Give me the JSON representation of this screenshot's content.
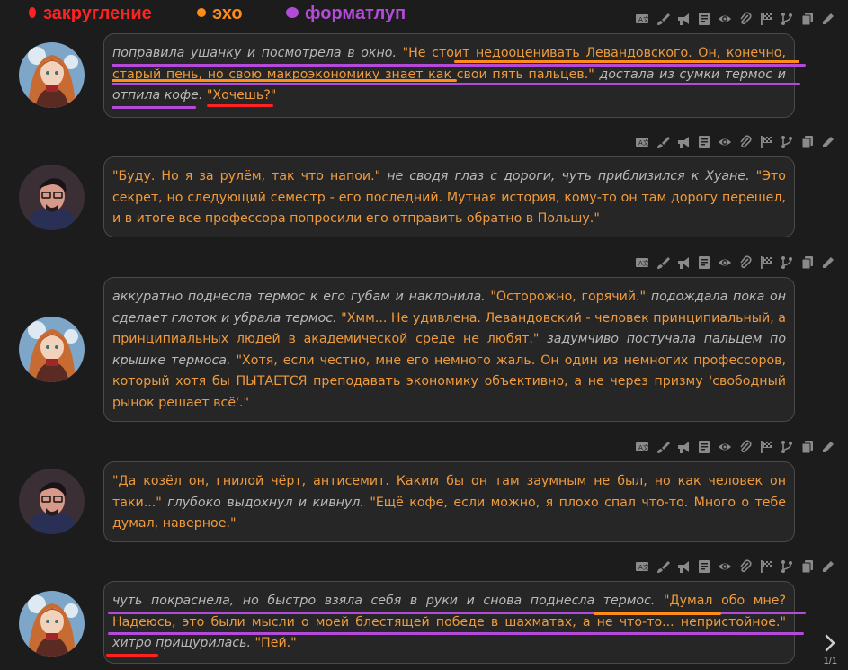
{
  "legend": [
    {
      "label": "закругление",
      "color": "#ff2222"
    },
    {
      "label": "эхо",
      "color": "#ff8c1a"
    },
    {
      "label": "форматлуп",
      "color": "#b44ad8"
    }
  ],
  "messages": [
    {
      "speaker": "girl",
      "parts": [
        {
          "t": "nar",
          "text": "поправила ушанку и посмотрела в окно. "
        },
        {
          "t": "sp",
          "text": "\"Не стоит недооценивать Левандовского. Он, конечно, старый пень, но свою макроэкономику знает как свои пять пальцев.\""
        },
        {
          "t": "nar",
          "text": " достала из сумки термос и отпила кофе. "
        },
        {
          "t": "sp",
          "text": "\"Хочешь?\""
        }
      ]
    },
    {
      "speaker": "guy",
      "parts": [
        {
          "t": "sp",
          "text": "\"Буду. Но я за рулём, так что напои.\""
        },
        {
          "t": "nar",
          "text": " не сводя глаз с дороги, чуть приблизился к Хуане. "
        },
        {
          "t": "sp",
          "text": "\"Это секрет, но следующий семестр - его последний. Мутная история, кому-то он там дорогу перешел, и в итоге все профессора попросили его отправить обратно в Польшу.\""
        }
      ]
    },
    {
      "speaker": "girl",
      "parts": [
        {
          "t": "nar",
          "text": "аккуратно поднесла термос к его губам и наклонила. "
        },
        {
          "t": "sp",
          "text": "\"Осторожно, горячий.\""
        },
        {
          "t": "nar",
          "text": " подождала пока он сделает глоток и убрала термос. "
        },
        {
          "t": "sp",
          "text": "\"Хмм... Не удивлена. Левандовский - человек принципиальный, а принципиальных людей в академической среде не любят.\""
        },
        {
          "t": "nar",
          "text": " задумчиво постучала пальцем по крышке термоса. "
        },
        {
          "t": "sp",
          "text": "\"Хотя, если честно, мне его немного жаль. Он один из немногих профессоров, который хотя бы ПЫТАЕТСЯ преподавать экономику объективно, а не через призму 'свободный рынок решает всё'.\""
        }
      ]
    },
    {
      "speaker": "guy",
      "parts": [
        {
          "t": "sp",
          "text": "\"Да козёл он, гнилой чёрт, антисемит. Каким бы он там заумным не был, но как человек он таки...\""
        },
        {
          "t": "nar",
          "text": " глубоко выдохнул и кивнул. "
        },
        {
          "t": "sp",
          "text": "\"Ещё кофе, если можно, я плохо спал что-то. Много о тебе думал, наверное.\""
        }
      ]
    },
    {
      "speaker": "girl",
      "parts": [
        {
          "t": "nar",
          "text": "чуть покраснела, но быстро взяла себя в руки и снова поднесла термос. "
        },
        {
          "t": "sp",
          "text": "\"Думал обо мне? Надеюсь, это были мысли о моей блестящей победе в шахматах, а не что-то... непристойное.\""
        },
        {
          "t": "nar",
          "text": " хитро прищурилась. "
        },
        {
          "t": "sp",
          "text": "\"Пей.\""
        }
      ]
    }
  ],
  "toolbar_icons": [
    "translate-icon",
    "brush-icon",
    "megaphone-icon",
    "note-icon",
    "eye-icon",
    "paperclip-icon",
    "flag-icon",
    "branch-icon",
    "copy-icon",
    "pencil-icon"
  ],
  "pager": {
    "text": "1/1"
  }
}
